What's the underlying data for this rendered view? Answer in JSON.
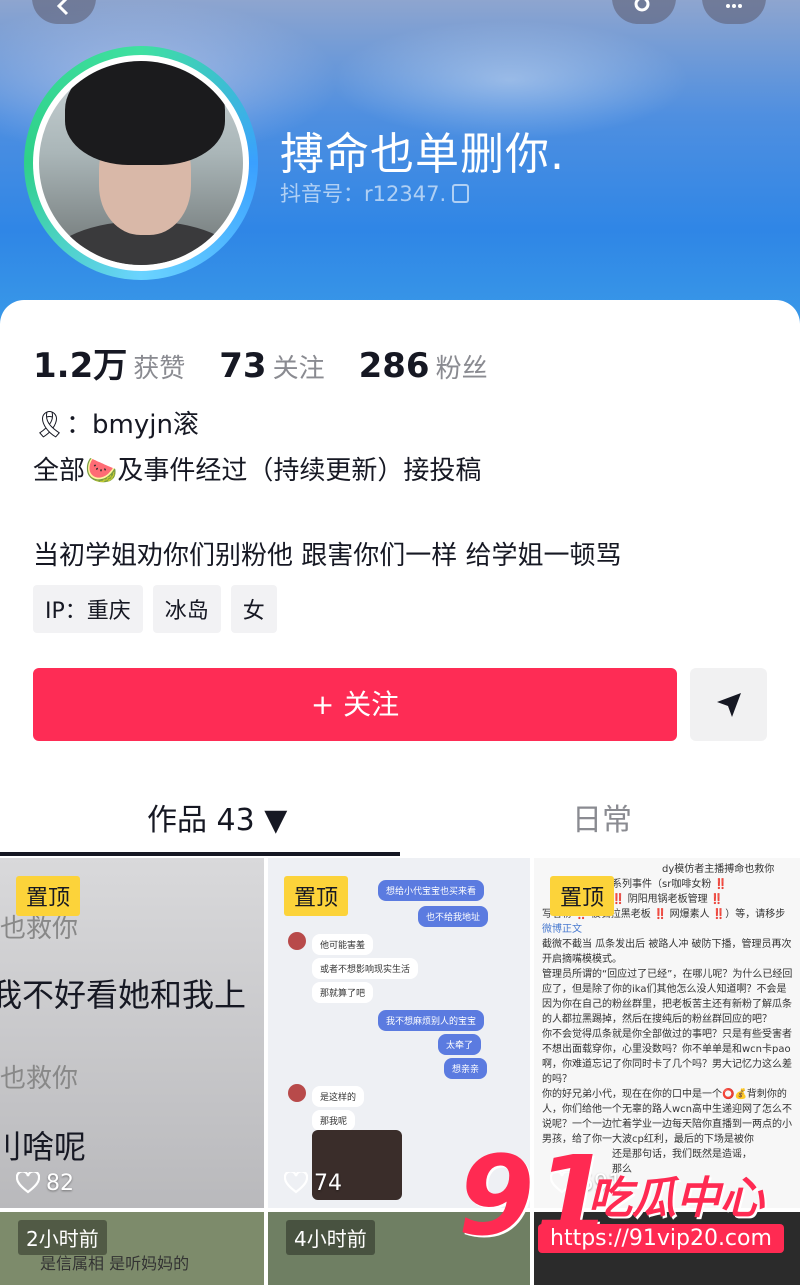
{
  "profile": {
    "username": "搏命也单删你.",
    "douyin_id": "抖音号：r12347."
  },
  "stats": {
    "likes_num": "1.2万",
    "likes_label": "获赞",
    "following_num": "73",
    "following_label": "关注",
    "followers_num": "286",
    "followers_label": "粉丝"
  },
  "bio": {
    "line1": "🎗：bmyjn滚",
    "line2": "全部🍉及事件经过（持续更新）接投稿",
    "line3": "当初学姐劝你们别粉他 跟害你们一样 给学姐一顿骂"
  },
  "tags": [
    "IP：重庆",
    "冰岛",
    "女"
  ],
  "actions": {
    "follow_label": "+ 关注"
  },
  "tabs": {
    "works": "作品 43 ▼",
    "daily": "日常"
  },
  "videos": [
    {
      "pinned": "置顶",
      "likes": "82",
      "text_top": "也救你",
      "text_main": "我不好看她和我上",
      "text_mid": "也救你",
      "text_bottom": "刂啥呢"
    },
    {
      "pinned": "置顶",
      "likes": "74",
      "chat": [
        "想给小代宝宝也买来看",
        "也不给我地址",
        "他可能害羞",
        "或者不想影响现实生活",
        "那就算了吧",
        "我不想麻烦别人的宝宝",
        "太牵了",
        "想亲亲",
        "是这样的",
        "那我呢"
      ]
    },
    {
      "pinned": "置顶",
      "likes": "591",
      "doc": [
        "dy模仿者主播搏命也救你",
        "系列事件（sr咖啡女粉 ‼️",
        "‼️ 阴阳甩锅老板管理 ‼️",
        "写者粉 ‼️ 被骗拉黑老板 ‼️ 网爆素人 ‼️）等，请移步",
        "微博正文",
        "截微不截当 瓜条发出后 被路人冲 破防下播，管理员再次开启摘嘴模模式。",
        "管理员所谓的“回应过了已经”，在哪儿呢？为什么已经回应了，但是除了你的ika们其他怎么没人知道啊？不会是因为你在自己的粉丝群里，把老板苦主还有新粉了解瓜条的人都拉黑踢掉，然后在搜纯后的粉丝群回应的吧？",
        "你不会觉得瓜条就是你全部做过的事吧？只是有些受害者不想出面载穿你，心里没数吗？你不单单是和wcn卡pao啊，你难道忘记了你同时卡了几个吗？男大记忆力这么差的吗？",
        "你的好兄弟小代，现在在你的口中是一个⭕💰背刺你的人，你们给他一个无辜的路人wcn高中生递迎网了怎么不说呢？一个一边忙着学业一边每天陪你直播到一两点的小男孩，给了你一大波cp红利，最后的下场是被你",
        "还是那句话，我们既然是造谣，",
        "那么"
      ]
    },
    {
      "time": "2小时前",
      "caption": "是信属相 是听妈妈的"
    },
    {
      "time": "4小时前"
    },
    {
      "time": ""
    }
  ],
  "watermark": {
    "big": "91",
    "cn": "吃瓜中心",
    "url": "https://91vip20.com"
  },
  "colors": {
    "follow_button": "#fe2c55",
    "pin_badge": "#fcd33a",
    "header": "#2f86e6"
  }
}
